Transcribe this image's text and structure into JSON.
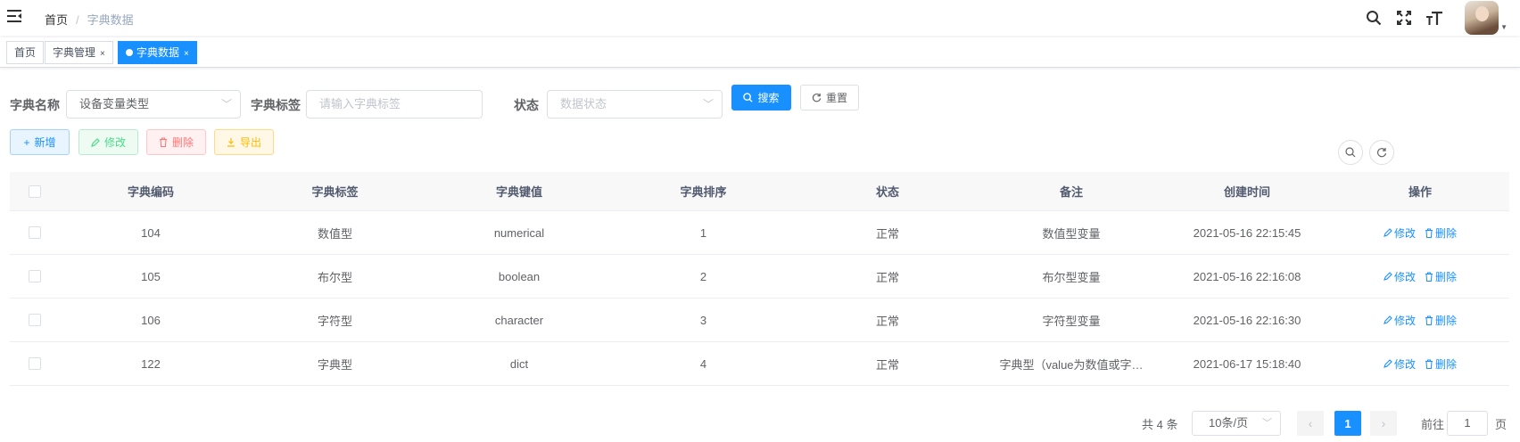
{
  "navbar": {
    "breadcrumb": {
      "home": "首页",
      "separator": "/",
      "current": "字典数据"
    },
    "icons": [
      "hamburger-icon",
      "search-icon",
      "fullscreen-icon",
      "font-size-icon",
      "avatar",
      "caret-down-icon"
    ]
  },
  "tags": [
    {
      "label": "首页",
      "active": false,
      "closable": false
    },
    {
      "label": "字典管理",
      "active": false,
      "closable": true
    },
    {
      "label": "字典数据",
      "active": true,
      "closable": true
    }
  ],
  "tag_close": "×",
  "form": {
    "dict_name_label": "字典名称",
    "dict_name_value": "设备变量类型",
    "dict_label_label": "字典标签",
    "dict_label_placeholder": "请输入字典标签",
    "status_label": "状态",
    "status_placeholder": "数据状态",
    "search_button": "搜索",
    "reset_button": "重置"
  },
  "toolbar": {
    "add": "新增",
    "edit": "修改",
    "delete": "删除",
    "export": "导出"
  },
  "table": {
    "headers": [
      "字典编码",
      "字典标签",
      "字典键值",
      "字典排序",
      "状态",
      "备注",
      "创建时间",
      "操作"
    ],
    "rows": [
      {
        "code": "104",
        "label": "数值型",
        "value": "numerical",
        "sort": "1",
        "status": "正常",
        "remark": "数值型变量",
        "created": "2021-05-16 22:15:45"
      },
      {
        "code": "105",
        "label": "布尔型",
        "value": "boolean",
        "sort": "2",
        "status": "正常",
        "remark": "布尔型变量",
        "created": "2021-05-16 22:16:08"
      },
      {
        "code": "106",
        "label": "字符型",
        "value": "character",
        "sort": "3",
        "status": "正常",
        "remark": "字符型变量",
        "created": "2021-05-16 22:16:30"
      },
      {
        "code": "122",
        "label": "字典型",
        "value": "dict",
        "sort": "4",
        "status": "正常",
        "remark": "字典型（value为数值或字…",
        "created": "2021-06-17 15:18:40"
      }
    ],
    "row_actions": {
      "edit": "修改",
      "delete": "删除"
    }
  },
  "pagination": {
    "total": "共 4 条",
    "page_size": "10条/页",
    "current_page": "1",
    "goto_label": "前往",
    "goto_value": "1",
    "page_suffix": "页"
  },
  "colors": {
    "primary": "#1890ff",
    "success": "#13ce66",
    "danger": "#ff4949",
    "warning": "#ffba00"
  }
}
